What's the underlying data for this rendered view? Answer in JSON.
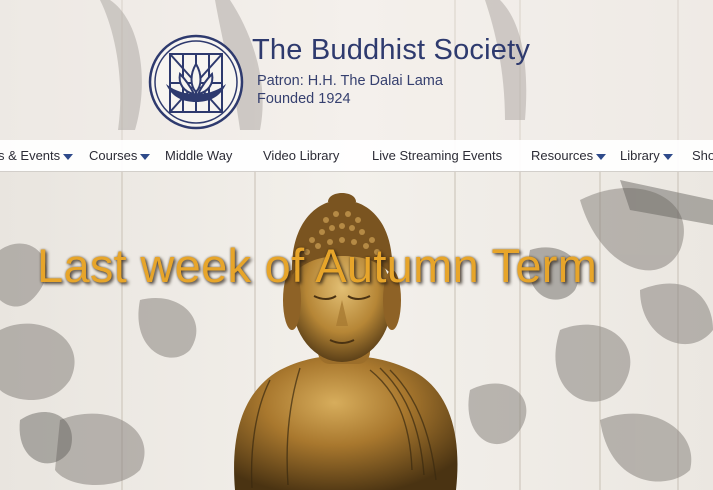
{
  "header": {
    "title": "The Buddhist Society",
    "patron": "Patron: H.H. The Dalai Lama",
    "founded": "Founded 1924",
    "logo_icon": "lotus-emblem-icon"
  },
  "nav": {
    "items": [
      {
        "label": "s & Events",
        "dropdown": true
      },
      {
        "label": "Courses",
        "dropdown": true
      },
      {
        "label": "Middle Way",
        "dropdown": false
      },
      {
        "label": "Video Library",
        "dropdown": false
      },
      {
        "label": "Live Streaming Events",
        "dropdown": false
      },
      {
        "label": "Resources",
        "dropdown": true
      },
      {
        "label": "Library",
        "dropdown": true
      },
      {
        "label": "Sho",
        "dropdown": false
      }
    ]
  },
  "hero": {
    "headline": "Last week of Autumn Term"
  },
  "colors": {
    "brand_navy": "#2e3a6e",
    "headline_gold": "#e7a52a",
    "caret_blue": "#2e4a8a"
  }
}
